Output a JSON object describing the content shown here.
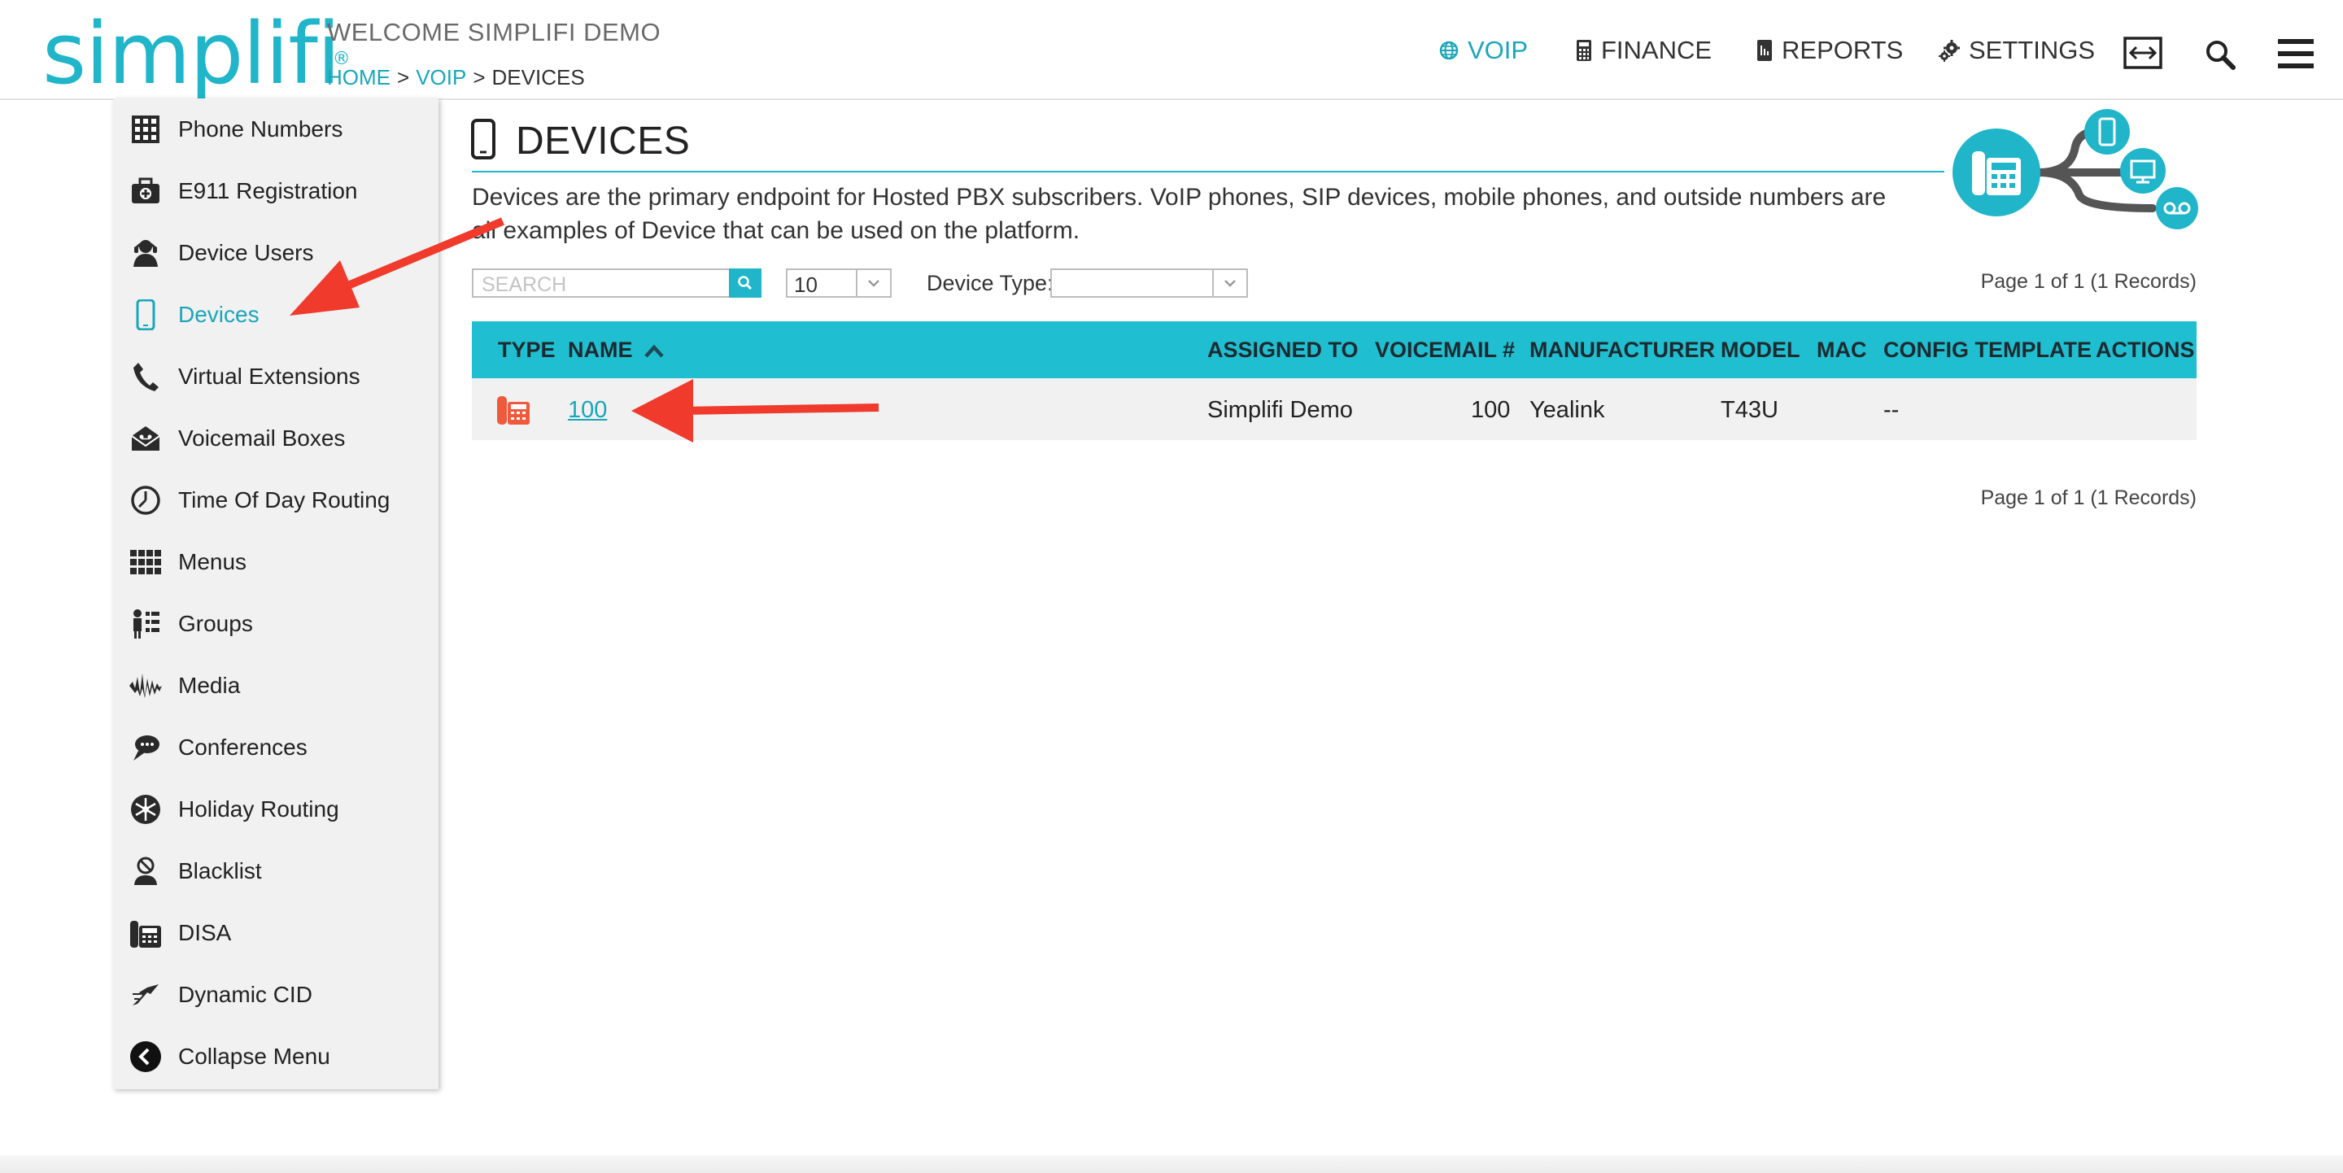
{
  "brand": {
    "logo": "simplifi",
    "accent": "#20b5c9",
    "header_band": "#20bed1",
    "arrow_color": "#f03a2c"
  },
  "header": {
    "welcome": "WELCOME SIMPLIFI DEMO",
    "breadcrumb": {
      "home": "HOME",
      "voip": "VOIP",
      "current": "DEVICES",
      "sep": ">"
    },
    "nav": {
      "voip": "VOIP",
      "finance": "FINANCE",
      "reports": "REPORTS",
      "settings": "SETTINGS"
    },
    "icons": [
      "globe-icon",
      "calculator-icon",
      "report-icon",
      "gear-icon",
      "expand-icon",
      "search-icon",
      "hamburger-menu-icon"
    ]
  },
  "sidebar": {
    "items": [
      {
        "label": "Phone Numbers",
        "icon": "phone-numbers-icon"
      },
      {
        "label": "E911 Registration",
        "icon": "e911-icon"
      },
      {
        "label": "Device Users",
        "icon": "device-users-icon"
      },
      {
        "label": "Devices",
        "icon": "mobile-device-icon",
        "active": true
      },
      {
        "label": "Virtual Extensions",
        "icon": "handset-icon"
      },
      {
        "label": "Voicemail Boxes",
        "icon": "voicemail-envelope-icon"
      },
      {
        "label": "Time Of Day Routing",
        "icon": "clock-icon"
      },
      {
        "label": "Menus",
        "icon": "grid-icon"
      },
      {
        "label": "Groups",
        "icon": "groups-icon"
      },
      {
        "label": "Media",
        "icon": "waveform-icon"
      },
      {
        "label": "Conferences",
        "icon": "chat-bubble-icon"
      },
      {
        "label": "Holiday Routing",
        "icon": "snowflake-icon"
      },
      {
        "label": "Blacklist",
        "icon": "blocked-user-icon"
      },
      {
        "label": "DISA",
        "icon": "desk-phone-icon"
      },
      {
        "label": "Dynamic CID",
        "icon": "dynamic-cid-icon"
      },
      {
        "label": "Collapse Menu",
        "icon": "collapse-left-icon"
      }
    ]
  },
  "page": {
    "title": "DEVICES",
    "description": "Devices are the primary endpoint for Hosted PBX subscribers. VoIP phones, SIP devices, mobile phones, and outside numbers are all examples of Device that can be used on the platform.",
    "search_placeholder": "SEARCH",
    "page_size": "10",
    "device_type_label": "Device Type:",
    "device_type_value": "",
    "pager_top": "Page 1 of 1 (1 Records)",
    "pager_bottom": "Page 1 of 1 (1 Records)"
  },
  "table": {
    "columns": {
      "type": "TYPE",
      "name": "NAME",
      "assigned_to": "ASSIGNED TO",
      "voicemail": "VOICEMAIL #",
      "manufacturer": "MANUFACTURER",
      "model": "MODEL",
      "mac": "MAC",
      "config_template": "CONFIG TEMPLATE",
      "actions": "ACTIONS"
    },
    "sort": {
      "column": "name",
      "direction": "ascending"
    },
    "rows": [
      {
        "type_icon": "desk-phone-icon",
        "name": "100",
        "assigned_to": "Simplifi Demo",
        "voicemail": "100",
        "manufacturer": "Yealink",
        "model": "T43U",
        "mac": "",
        "config_template": "--",
        "actions": ""
      }
    ]
  }
}
